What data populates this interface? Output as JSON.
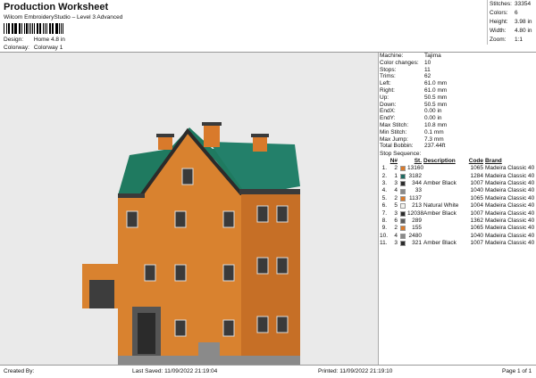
{
  "header": {
    "title": "Production Worksheet",
    "subtitle": "Wilcom EmbroideryStudio – Level 3 Advanced",
    "design_label": "Design:",
    "design_value": "Home 4.8 in",
    "colorway_label": "Colorway:",
    "colorway_value": "Colorway 1"
  },
  "stats": [
    {
      "k": "Stitches:",
      "v": "33354"
    },
    {
      "k": "Colors:",
      "v": "6"
    },
    {
      "k": "Height:",
      "v": "3.98 in"
    },
    {
      "k": "Width:",
      "v": "4.80 in"
    },
    {
      "k": "Zoom:",
      "v": "1:1"
    }
  ],
  "info": [
    {
      "k": "Machine:",
      "v": "Tajima"
    },
    {
      "k": "Color changes:",
      "v": "10"
    },
    {
      "k": "Stops:",
      "v": "11"
    },
    {
      "k": "Trims:",
      "v": "62"
    },
    {
      "k": "Left:",
      "v": "61.0 mm"
    },
    {
      "k": "Right:",
      "v": "61.0 mm"
    },
    {
      "k": "Up:",
      "v": "50.5 mm"
    },
    {
      "k": "Down:",
      "v": "50.5 mm"
    },
    {
      "k": "EndX:",
      "v": "0.00 in"
    },
    {
      "k": "EndY:",
      "v": "0.00 in"
    },
    {
      "k": "Max Stitch:",
      "v": "10.8 mm"
    },
    {
      "k": "Min Stitch:",
      "v": "0.1 mm"
    },
    {
      "k": "Max Jump:",
      "v": "7.3 mm"
    },
    {
      "k": "Total Bobbin:",
      "v": "237.44ft"
    }
  ],
  "sequence": {
    "title": "Stop Sequence:",
    "headers": {
      "n": "N#",
      "st": "St.",
      "desc": "Description",
      "code": "Code",
      "brand": "Brand"
    },
    "rows": [
      {
        "num": "1.",
        "n": "2",
        "color": "#d97a2b",
        "st": "13160",
        "desc": "",
        "code": "1065",
        "brand": "Madeira Classic 40"
      },
      {
        "num": "2.",
        "n": "1",
        "color": "#1f6b62",
        "st": "3182",
        "desc": "",
        "code": "1284",
        "brand": "Madeira Classic 40"
      },
      {
        "num": "3.",
        "n": "3",
        "color": "#2b2b2b",
        "st": "344",
        "desc": "Amber Black",
        "code": "1007",
        "brand": "Madeira Classic 40"
      },
      {
        "num": "4.",
        "n": "4",
        "color": "#8a8a8a",
        "st": "33",
        "desc": "",
        "code": "1040",
        "brand": "Madeira Classic 40"
      },
      {
        "num": "5.",
        "n": "2",
        "color": "#d97a2b",
        "st": "1137",
        "desc": "",
        "code": "1065",
        "brand": "Madeira Classic 40"
      },
      {
        "num": "6.",
        "n": "5",
        "color": "#f4f4f0",
        "st": "213",
        "desc": "Natural White",
        "code": "1004",
        "brand": "Madeira Classic 40"
      },
      {
        "num": "7.",
        "n": "3",
        "color": "#2b2b2b",
        "st": "12038",
        "desc": "Amber Black",
        "code": "1007",
        "brand": "Madeira Classic 40"
      },
      {
        "num": "8.",
        "n": "6",
        "color": "#5c5c5c",
        "st": "289",
        "desc": "",
        "code": "1362",
        "brand": "Madeira Classic 40"
      },
      {
        "num": "9.",
        "n": "2",
        "color": "#d97a2b",
        "st": "155",
        "desc": "",
        "code": "1065",
        "brand": "Madeira Classic 40"
      },
      {
        "num": "10.",
        "n": "4",
        "color": "#8a8a8a",
        "st": "2480",
        "desc": "",
        "code": "1040",
        "brand": "Madeira Classic 40"
      },
      {
        "num": "11.",
        "n": "3",
        "color": "#2b2b2b",
        "st": "321",
        "desc": "Amber Black",
        "code": "1007",
        "brand": "Madeira Classic 40"
      }
    ]
  },
  "footer": {
    "created": "Created By:",
    "saved": "Last Saved: 11/09/2022 21:19:04",
    "printed": "Printed: 11/09/2022 21:19:10",
    "page": "Page 1 of 1"
  }
}
